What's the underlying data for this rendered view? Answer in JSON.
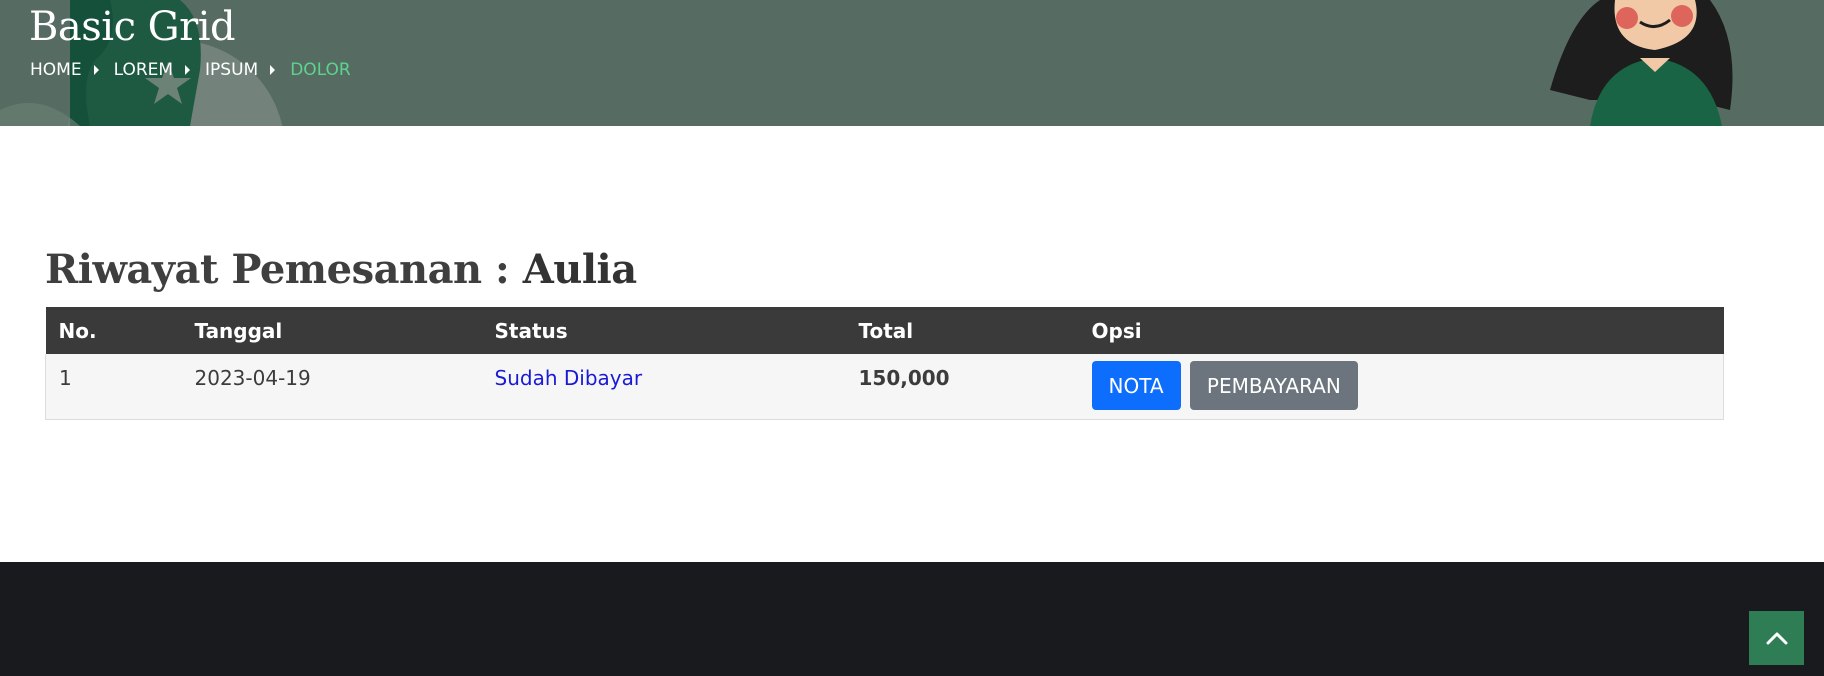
{
  "hero": {
    "title": "Basic Grid",
    "breadcrumb": [
      "HOME",
      "LOREM",
      "IPSUM",
      "DOLOR"
    ]
  },
  "main": {
    "heading_prefix": "Riwayat Pemesanan :",
    "heading_name": "Aulia",
    "table": {
      "columns": [
        "No.",
        "Tanggal",
        "Status",
        "Total",
        "Opsi"
      ],
      "rows": [
        {
          "no": "1",
          "tanggal": "2023-04-19",
          "status": "Sudah Dibayar",
          "total": "150,000",
          "actions": [
            "NOTA",
            "PEMBAYARAN"
          ]
        }
      ]
    }
  },
  "icons": {
    "breadcrumb_separator": "caret-right-icon",
    "back_to_top": "chevron-up-icon"
  },
  "colors": {
    "hero_bg": "#566c62",
    "breadcrumb_active": "#5dd38e",
    "table_header_bg": "#3a3a3a",
    "status_link": "#1a1ad4",
    "btn_primary": "#0d6efd",
    "btn_secondary": "#6c757d",
    "footer_bg": "#191a1d",
    "back_to_top_bg": "#2f7d55"
  }
}
